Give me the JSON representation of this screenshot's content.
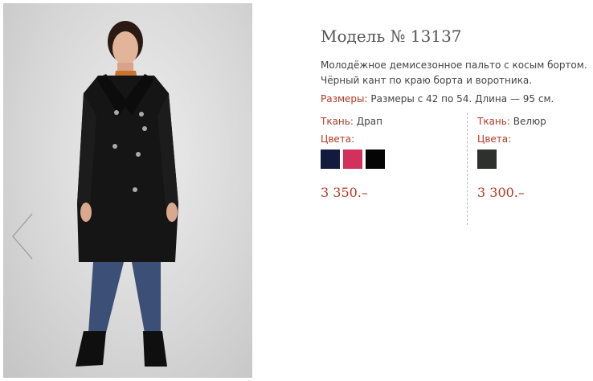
{
  "product": {
    "title": "Модель № 13137",
    "description": "Молодёжное демисезонное пальто с косым бортом. Чёрный кант по краю борта и воротника.",
    "sizes_label": "Размеры:",
    "sizes_value": "Размеры с 42 по 54. Длина — 95 см."
  },
  "variants": [
    {
      "fabric_label": "Ткань:",
      "fabric_value": "Драп",
      "colors_label": "Цвета:",
      "swatches": [
        {
          "name": "navy",
          "color": "#121a3e"
        },
        {
          "name": "pink",
          "color": "#d3305e"
        },
        {
          "name": "black",
          "color": "#050505"
        }
      ],
      "price": "3 350.–"
    },
    {
      "fabric_label": "Ткань:",
      "fabric_value": "Велюр",
      "colors_label": "Цвета:",
      "swatches": [
        {
          "name": "dark-grey",
          "color": "#2e302e"
        }
      ],
      "price": "3 300.–"
    }
  ],
  "gallery": {
    "prev_icon": "chevron-left-icon"
  },
  "colors": {
    "accent": "#b53a23",
    "text": "#444444"
  }
}
